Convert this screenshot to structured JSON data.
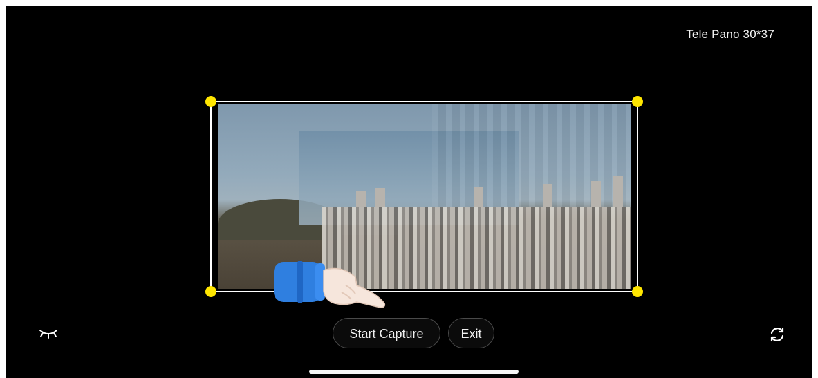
{
  "mode": {
    "label": "Tele Pano 30*37"
  },
  "controls": {
    "start_label": "Start Capture",
    "exit_label": "Exit"
  },
  "icons": {
    "left": "closed-eye-icon",
    "right": "rotate-camera-icon",
    "hand": "pointing-hand-icon"
  },
  "colors": {
    "corner_handles": "#ffe600",
    "frame": "#ffffff",
    "background": "#000000"
  }
}
